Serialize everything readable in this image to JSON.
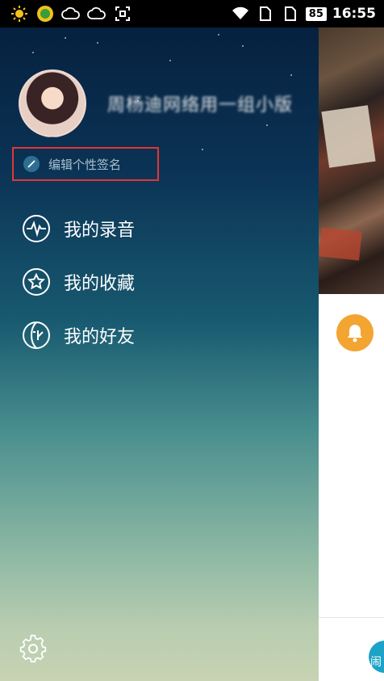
{
  "status_bar": {
    "icons_left": [
      "sun-icon",
      "app-badge-icon",
      "cloud-icon",
      "cloud-icon",
      "screenshot-icon"
    ],
    "icons_right": [
      "wifi-icon",
      "sim-icon",
      "sim-icon"
    ],
    "battery_level": "85",
    "time": "16:55"
  },
  "drawer": {
    "username": "周杨迪网络用一组小版",
    "signature_label": "编辑个性签名",
    "signature_highlight_color": "#e53535",
    "menu": [
      {
        "label": "我的录音",
        "icon": "waveform-icon"
      },
      {
        "label": "我的收藏",
        "icon": "star-icon"
      },
      {
        "label": "我的好友",
        "icon": "friends-icon"
      }
    ],
    "settings_icon": "gear-icon"
  },
  "background_app": {
    "bell_icon": "bell-icon",
    "bell_color": "#f3a531",
    "active_tab_partial_label": "闹",
    "accent_color": "#1ca3c7"
  }
}
